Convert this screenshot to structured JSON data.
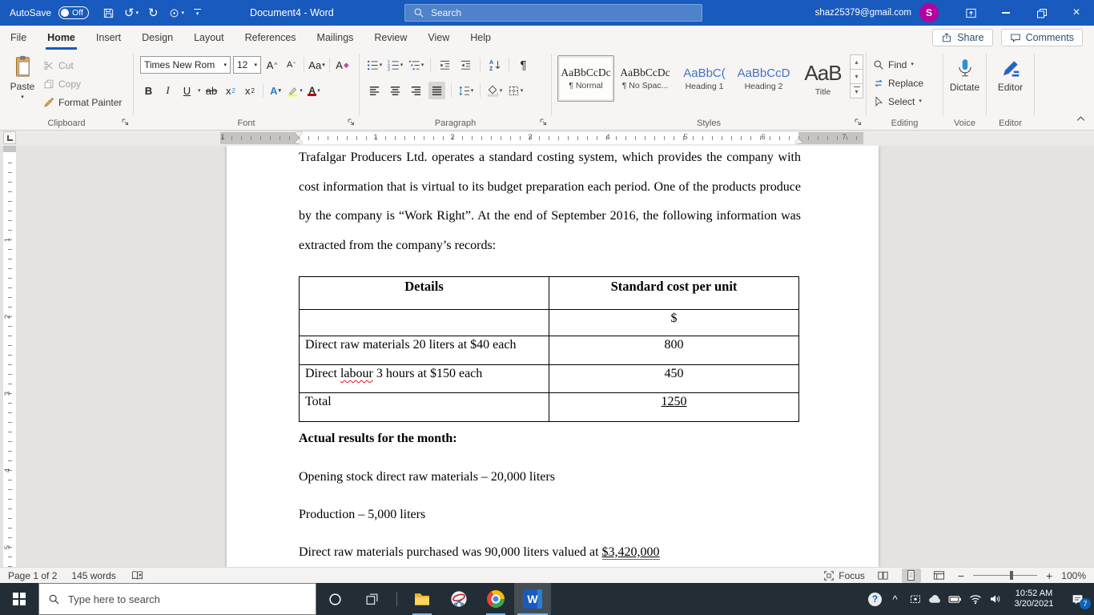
{
  "title_bar": {
    "autosave_label": "AutoSave",
    "autosave_state": "Off",
    "document_title": "Document4 - Word",
    "search_placeholder": "Search",
    "account_email": "shaz25379@gmail.com",
    "avatar_initial": "S"
  },
  "ribbon": {
    "tabs": [
      "File",
      "Home",
      "Insert",
      "Design",
      "Layout",
      "References",
      "Mailings",
      "Review",
      "View",
      "Help"
    ],
    "active_tab": "Home",
    "share_label": "Share",
    "comments_label": "Comments",
    "clipboard": {
      "group_label": "Clipboard",
      "paste_label": "Paste",
      "cut_label": "Cut",
      "copy_label": "Copy",
      "format_painter_label": "Format Painter"
    },
    "font": {
      "group_label": "Font",
      "font_name": "Times New Rom",
      "font_size": "12"
    },
    "paragraph": {
      "group_label": "Paragraph"
    },
    "styles": {
      "group_label": "Styles",
      "items": [
        {
          "preview": "AaBbCcDc",
          "name": "¶ Normal"
        },
        {
          "preview": "AaBbCcDc",
          "name": "¶ No Spac..."
        },
        {
          "preview": "AaBbC(",
          "name": "Heading 1"
        },
        {
          "preview": "AaBbCcD",
          "name": "Heading 2"
        },
        {
          "preview": "AaB",
          "name": "Title"
        }
      ]
    },
    "editing": {
      "group_label": "Editing",
      "find_label": "Find",
      "replace_label": "Replace",
      "select_label": "Select"
    },
    "voice": {
      "group_label": "Voice",
      "dictate_label": "Dictate"
    },
    "editor_group": {
      "group_label": "Editor",
      "editor_label": "Editor"
    }
  },
  "ruler": {
    "h_marks": [
      "1",
      "1",
      "2",
      "3",
      "4",
      "5",
      "6",
      "7"
    ],
    "v_marks": [
      "1",
      "2",
      "3",
      "4",
      "5"
    ]
  },
  "document": {
    "intro_lines": [
      "Trafalgar Producers Ltd. operates a standard costing system, which provides the company with",
      "cost information that is virtual to its budget preparation each period. One of the products produce",
      "by the company is “Work Right”. At the end of September 2016, the following information was",
      "extracted from the company’s records:"
    ],
    "table": {
      "header": [
        "Details",
        "Standard cost per unit"
      ],
      "currency_row": "$",
      "rows": [
        {
          "label": "Direct raw materials 20 liters at $40 each",
          "value": "800"
        },
        {
          "label_pre": "Direct ",
          "label_misspelled": "labour",
          "label_post": " 3 hours at $150 each",
          "value": "450"
        },
        {
          "label": "Total",
          "value": "1250"
        }
      ]
    },
    "actual_results_heading": "Actual results for the month:",
    "opening_stock_line": "Opening stock direct raw materials – 20,000 liters",
    "production_line": "Production – 5,000 liters",
    "purchase_line_pre": "Direct raw materials purchased was 90,000 liters valued at ",
    "purchase_line_value": "$3,420,000"
  },
  "status_bar": {
    "page_indicator": "Page 1 of 2",
    "word_count": "145 words",
    "focus_label": "Focus",
    "zoom_level": "100%"
  },
  "taskbar": {
    "search_placeholder": "Type here to search",
    "time": "10:52 AM",
    "date": "3/20/2021",
    "notification_count": "7"
  },
  "colors": {
    "titlebar_blue": "#185abd",
    "avatar_purple": "#b4009e",
    "taskbar_dark": "#222d35",
    "heading_style_blue": "#4472c4",
    "font_color_red": "#c00000"
  }
}
